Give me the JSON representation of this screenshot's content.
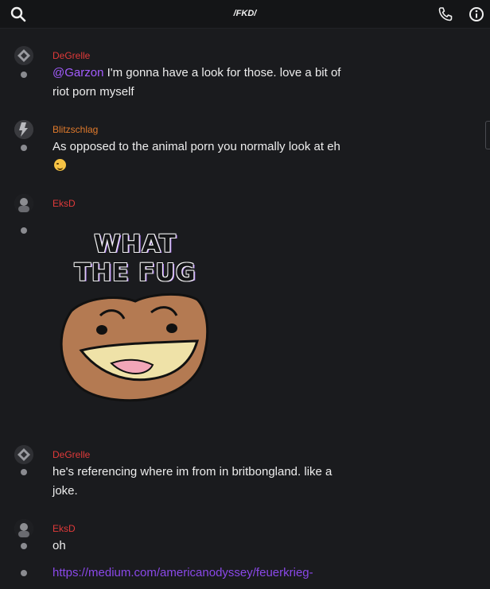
{
  "header": {
    "title": "/FKD/",
    "icons": [
      "search-icon",
      "phone-icon",
      "info-icon"
    ]
  },
  "messages": [
    {
      "username": "DeGrelle",
      "username_color": "#e03a3a",
      "mention": "@Garzon",
      "text": " I'm gonna have a look for those. love a bit of riot porn myself"
    },
    {
      "username": "Blitzschlag",
      "username_color": "#e07a2c",
      "text": "As opposed to the animal porn you normally look at eh",
      "emoji": "winking-face"
    },
    {
      "username": "EksD",
      "username_color": "#e03a3a",
      "meme_caption_line1": "WHAT",
      "meme_caption_line2": "THE FUG"
    },
    {
      "username": "DeGrelle",
      "username_color": "#e03a3a",
      "text": "he's referencing where im from in britbongland. like a joke."
    },
    {
      "username": "EksD",
      "username_color": "#e03a3a",
      "text": "oh",
      "link": "https://medium.com/americanodyssey/feuerkrieg-"
    }
  ],
  "colors": {
    "background": "#1a1b1e",
    "topbar": "#141517",
    "mention": "#a35cff",
    "link": "#8a48e8"
  }
}
